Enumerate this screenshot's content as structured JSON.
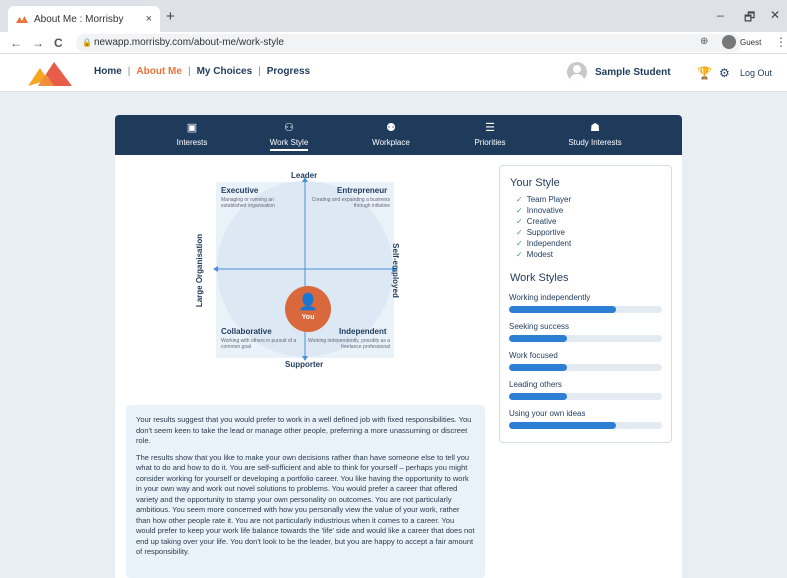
{
  "browser": {
    "tab_title": "About Me : Morrisby",
    "tab_close": "×",
    "new_tab": "+",
    "url": "newapp.morrisby.com/about-me/work-style",
    "profile_label": "Guest",
    "win_min": "–",
    "win_max": "🗗",
    "win_close": "✕",
    "back": "←",
    "forward": "→",
    "reload": "C",
    "zoom": "⊕",
    "menu": "⋮"
  },
  "header": {
    "nav": [
      "Home",
      "About Me",
      "My Choices",
      "Progress"
    ],
    "active": "About Me",
    "user_name": "Sample Student",
    "logout": "Log Out"
  },
  "section_nav": [
    {
      "label": "Interests",
      "icon": "id-card-icon"
    },
    {
      "label": "Work Style",
      "icon": "person-gear-icon"
    },
    {
      "label": "Workplace",
      "icon": "people-icon"
    },
    {
      "label": "Priorities",
      "icon": "list-icon"
    },
    {
      "label": "Study Interests",
      "icon": "student-icon"
    }
  ],
  "section_nav_active": "Work Style",
  "diagram": {
    "top": "Leader",
    "bottom": "Supporter",
    "left": "Large Organisation",
    "right": "Self-employed",
    "quadrants": {
      "tl": {
        "title": "Executive",
        "desc": "Managing or running an established organisation"
      },
      "tr": {
        "title": "Entrepreneur",
        "desc": "Creating and expanding a business through initiative"
      },
      "bl": {
        "title": "Collaborative",
        "desc": "Working with others in pursuit of a common goal"
      },
      "br": {
        "title": "Independent",
        "desc": "Working independently, possibly as a freelance professional"
      }
    },
    "you_label": "You"
  },
  "your_style": {
    "title": "Your Style",
    "traits": [
      "Team Player",
      "Innovative",
      "Creative",
      "Supportive",
      "Independent",
      "Modest"
    ]
  },
  "work_styles": {
    "title": "Work Styles",
    "items": [
      {
        "label": "Working independently",
        "value": 0.7
      },
      {
        "label": "Seeking success",
        "value": 0.38
      },
      {
        "label": "Work focused",
        "value": 0.38
      },
      {
        "label": "Leading others",
        "value": 0.38
      },
      {
        "label": "Using your own ideas",
        "value": 0.7
      }
    ]
  },
  "summary": {
    "p1": "Your results suggest that you would prefer to work in a well defined job with fixed responsibilities. You don't seem keen to take the lead or manage other people, preferring a more unassuming or discreet role.",
    "p2": "The results show that you like to make your own decisions rather than have someone else to tell you what to do and how to do it. You are self-sufficient and able to think for yourself – perhaps you might consider working for yourself or developing a portfolio career. You like having the opportunity to work in your own way and work out novel solutions to problems. You would prefer a career that offered variety and the opportunity to stamp your own personality on outcomes. You are not particularly ambitious. You seem more concerned with how you personally view the value of your work, rather than how other people rate it. You are not particularly industrious when it comes to a career. You would prefer to keep your work life balance towards the 'life' side and would like a career that does not end up taking over your life. You don't look to be the leader, but you are happy to accept a fair amount of responsibility."
  },
  "colors": {
    "navy": "#1f3b5c",
    "accent": "#e8743b",
    "bar": "#2d7fd4",
    "you": "#d9693c"
  }
}
